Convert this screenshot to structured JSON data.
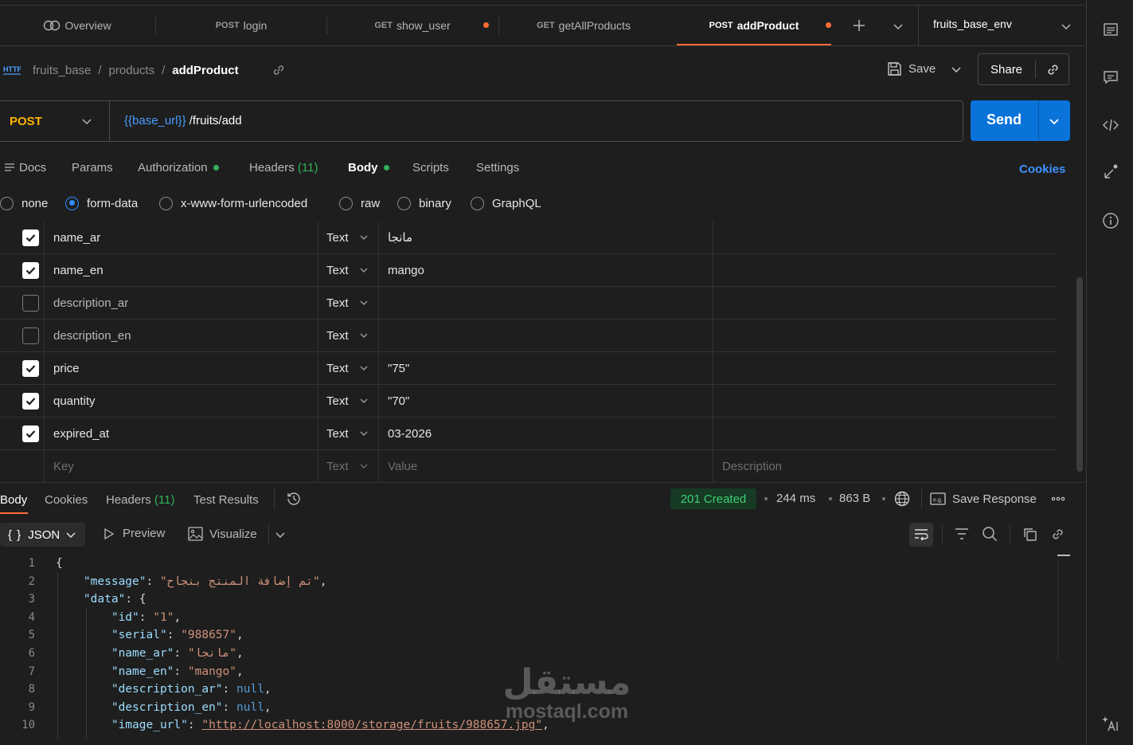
{
  "tabs": [
    {
      "method": "",
      "label": "Overview"
    },
    {
      "method": "POST",
      "label": "login"
    },
    {
      "method": "GET",
      "label": "show_user"
    },
    {
      "method": "GET",
      "label": "getAllProducts"
    },
    {
      "method": "POST",
      "label": "addProduct"
    }
  ],
  "environment": "fruits_base_env",
  "breadcrumb": {
    "collection": "fruits_base",
    "folder": "products",
    "request": "addProduct",
    "sep": "/"
  },
  "toolbar": {
    "save_label": "Save",
    "share_label": "Share"
  },
  "request": {
    "method": "POST",
    "url_var": "{{base_url}}",
    "url_path": " /fruits/add",
    "send_label": "Send"
  },
  "request_tabs": {
    "docs": "Docs",
    "params": "Params",
    "authorization": "Authorization",
    "headers": "Headers",
    "headers_count": "(11)",
    "body": "Body",
    "scripts": "Scripts",
    "settings": "Settings",
    "cookies": "Cookies"
  },
  "body_types": [
    "none",
    "form-data",
    "x-www-form-urlencoded",
    "raw",
    "binary",
    "GraphQL"
  ],
  "body_type_selected": "form-data",
  "form_rows": [
    {
      "checked": true,
      "key": "name_ar",
      "type": "Text",
      "value": "مانجا"
    },
    {
      "checked": true,
      "key": "name_en",
      "type": "Text",
      "value": "mango"
    },
    {
      "checked": false,
      "key": "description_ar",
      "type": "Text",
      "value": ""
    },
    {
      "checked": false,
      "key": "description_en",
      "type": "Text",
      "value": ""
    },
    {
      "checked": true,
      "key": "price",
      "type": "Text",
      "value": "\"75\""
    },
    {
      "checked": true,
      "key": "quantity",
      "type": "Text",
      "value": "\"70\""
    },
    {
      "checked": true,
      "key": "expired_at",
      "type": "Text",
      "value": "03-2026"
    }
  ],
  "form_placeholders": {
    "key": "Key",
    "type": "Text",
    "value": "Value",
    "description": "Description"
  },
  "response": {
    "tabs": {
      "body": "Body",
      "cookies": "Cookies",
      "headers": "Headers",
      "headers_count": "(11)",
      "tests": "Test Results"
    },
    "status": "201 Created",
    "time": "244 ms",
    "size": "863 B",
    "save_response": "Save Response",
    "format": "JSON",
    "preview": "Preview",
    "visualize": "Visualize"
  },
  "code_lines": [
    {
      "n": "1",
      "t": "{"
    },
    {
      "n": "2",
      "t": "    \"message\": \"تم إضافة المنتج بنجاح\","
    },
    {
      "n": "3",
      "t": "    \"data\": {"
    },
    {
      "n": "4",
      "t": "        \"id\": \"1\","
    },
    {
      "n": "5",
      "t": "        \"serial\": \"988657\","
    },
    {
      "n": "6",
      "t": "        \"name_ar\": \"مانجا\","
    },
    {
      "n": "7",
      "t": "        \"name_en\": \"mango\","
    },
    {
      "n": "8",
      "t": "        \"description_ar\": null,"
    },
    {
      "n": "9",
      "t": "        \"description_en\": null,"
    },
    {
      "n": "10",
      "t": "        \"image_url\": \"http://localhost:8000/storage/fruits/988657.jpg\","
    }
  ],
  "watermark": {
    "arabic": "مستقل",
    "latin": "mostaql.com"
  },
  "colors": {
    "accent_orange": "#ff6c37",
    "send_blue": "#0a73d9",
    "status_green": "#3fcf73",
    "post_yellow": "#ffb400"
  }
}
